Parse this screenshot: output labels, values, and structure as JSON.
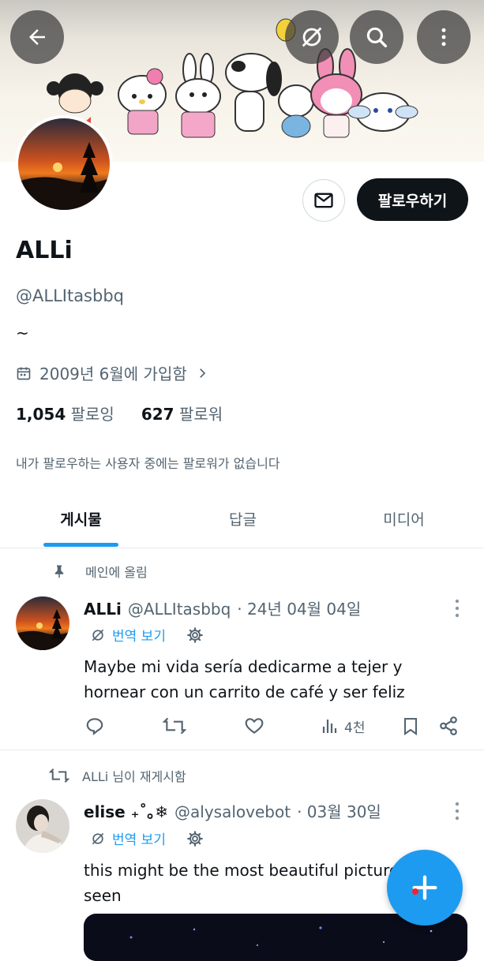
{
  "header": {
    "back_icon": "arrow-left-icon",
    "translate_icon": "translate-off-icon",
    "search_icon": "search-icon",
    "more_icon": "more-vertical-icon"
  },
  "profile": {
    "name": "ALLi",
    "handle": "@ALLItasbbq",
    "bio": "~",
    "joined": "2009년 6월에 가입함",
    "following_count": "1,054",
    "following_label": "팔로잉",
    "followers_count": "627",
    "followers_label": "팔로워",
    "follow_button": "팔로우하기",
    "mutual_notice": "내가 팔로우하는 사용자 중에는 팔로워가 없습니다"
  },
  "tabs": [
    {
      "label": "게시물",
      "active": true
    },
    {
      "label": "답글",
      "active": false
    },
    {
      "label": "미디어",
      "active": false
    }
  ],
  "posts": [
    {
      "context": "메인에 올림",
      "context_icon": "pin-icon",
      "name": "ALLi",
      "handle": "@ALLItasbbq",
      "date": "· 24년 04월 04일",
      "translate_label": "번역 보기",
      "text": "Maybe mi vida sería dedicarme a tejer y hornear con un carrito de café y ser feliz",
      "views": "4천"
    },
    {
      "context": "ALLi 님이 재게시함",
      "context_icon": "repost-icon",
      "name": "elise ₊˚｡❄",
      "handle": "@alysalovebot",
      "date": "· 03월 30일",
      "translate_label": "번역 보기",
      "text": "this might be the most beautiful picture ever seen"
    }
  ],
  "colors": {
    "accent": "#1d9bf0",
    "text": "#0f1419",
    "secondary": "#536471"
  }
}
